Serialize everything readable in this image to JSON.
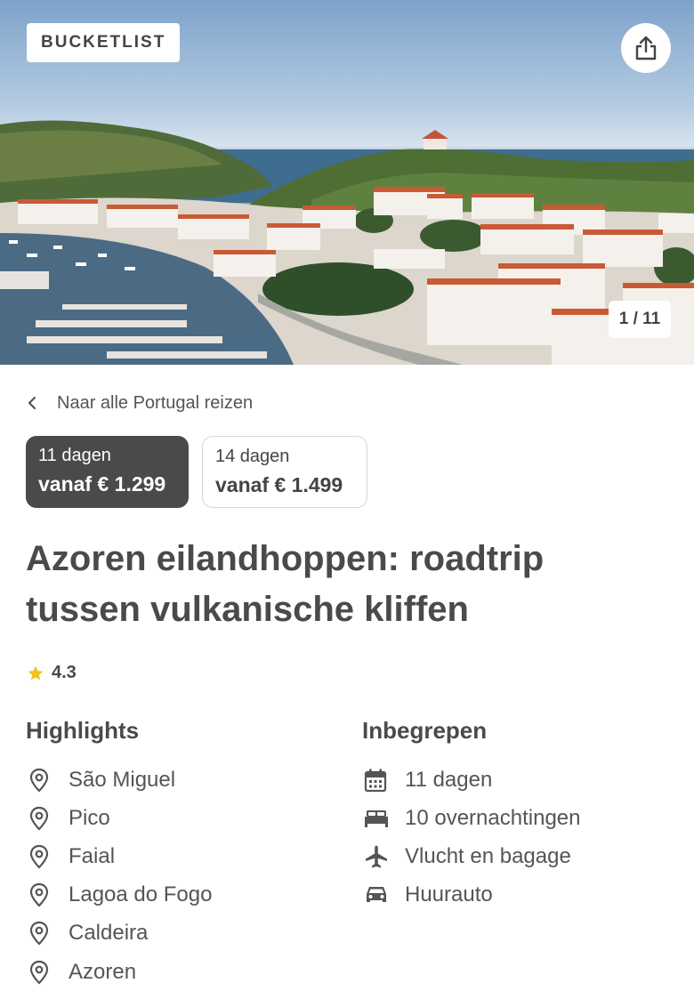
{
  "hero": {
    "badge": "BUCKETLIST",
    "counter": "1 / 11",
    "share_icon": "share-icon"
  },
  "back_link": {
    "label": "Naar alle Portugal reizen",
    "icon": "chevron-left-icon"
  },
  "options": [
    {
      "days": "11 dagen",
      "price": "vanaf € 1.299",
      "selected": true
    },
    {
      "days": "14 dagen",
      "price": "vanaf € 1.499",
      "selected": false
    }
  ],
  "title": "Azoren eilandhoppen: roadtrip tussen vulkanische kliffen",
  "rating": {
    "value": "4.3",
    "icon": "star-icon",
    "color": "#f5c01b"
  },
  "highlights": {
    "heading": "Highlights",
    "icon": "location-pin-icon",
    "items": [
      "São Miguel",
      "Pico",
      "Faial",
      "Lagoa do Fogo",
      "Caldeira",
      "Azoren"
    ]
  },
  "included": {
    "heading": "Inbegrepen",
    "items": [
      {
        "icon": "calendar-icon",
        "label": "11 dagen"
      },
      {
        "icon": "bed-icon",
        "label": "10 overnachtingen"
      },
      {
        "icon": "airplane-icon",
        "label": "Vlucht en bagage"
      },
      {
        "icon": "car-icon",
        "label": "Huurauto"
      }
    ]
  },
  "colors": {
    "active_option_bg": "#4a4a4a",
    "text": "#4a4a4a",
    "star": "#f5c01b"
  }
}
